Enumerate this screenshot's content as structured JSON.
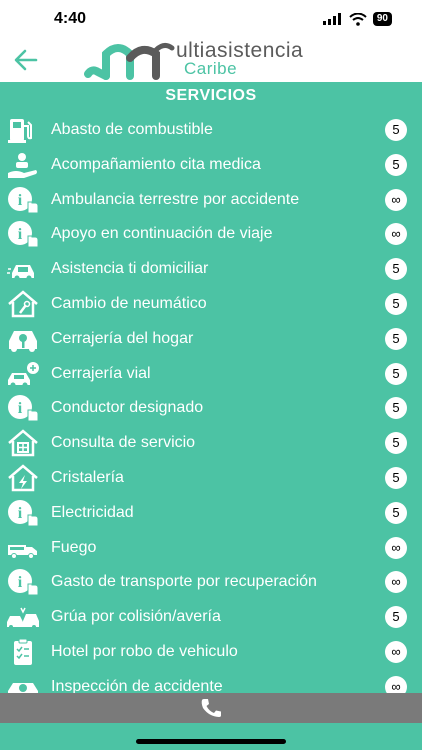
{
  "status": {
    "time": "4:40",
    "battery": "90"
  },
  "header": {
    "logo_line1": "ultiasistencia",
    "logo_line2": "Caribe",
    "back_icon": "arrow-left-icon"
  },
  "section": {
    "title": "SERVICIOS"
  },
  "services": [
    {
      "label": "Abasto de combustible",
      "badge": "5",
      "icon": "fuel-pump-icon"
    },
    {
      "label": "Acompañamiento cita medica",
      "badge": "5",
      "icon": "medical-hand-icon"
    },
    {
      "label": "Ambulancia terrestre por accidente",
      "badge": "∞",
      "icon": "info-hand-icon"
    },
    {
      "label": "Apoyo en continuación de viaje",
      "badge": "∞",
      "icon": "info-hand-icon"
    },
    {
      "label": "Asistencia ti domiciliar",
      "badge": "5",
      "icon": "car-icon"
    },
    {
      "label": "Cambio de neumático",
      "badge": "5",
      "icon": "house-wrench-icon"
    },
    {
      "label": "Cerrajería del hogar",
      "badge": "5",
      "icon": "car-key-icon"
    },
    {
      "label": "Cerrajería vial",
      "badge": "5",
      "icon": "car-lock-icon"
    },
    {
      "label": "Conductor designado",
      "badge": "5",
      "icon": "info-hand-icon"
    },
    {
      "label": "Consulta de servicio",
      "badge": "5",
      "icon": "house-window-icon"
    },
    {
      "label": "Cristalería",
      "badge": "5",
      "icon": "house-bolt-icon"
    },
    {
      "label": "Electricidad",
      "badge": "5",
      "icon": "info-hand-icon"
    },
    {
      "label": "Fuego",
      "badge": "∞",
      "icon": "truck-icon"
    },
    {
      "label": "Gasto de transporte por recuperación",
      "badge": "∞",
      "icon": "info-hand-icon"
    },
    {
      "label": "Grúa por colisión/avería",
      "badge": "5",
      "icon": "car-crash-icon"
    },
    {
      "label": "Hotel por robo de vehiculo",
      "badge": "∞",
      "icon": "clipboard-icon"
    },
    {
      "label": "Inspección de accidente",
      "badge": "∞",
      "icon": "mechanic-icon"
    }
  ],
  "footer": {
    "icon": "phone-icon"
  },
  "colors": {
    "accent": "#4cc3a4",
    "footer": "#7a7a7a"
  }
}
